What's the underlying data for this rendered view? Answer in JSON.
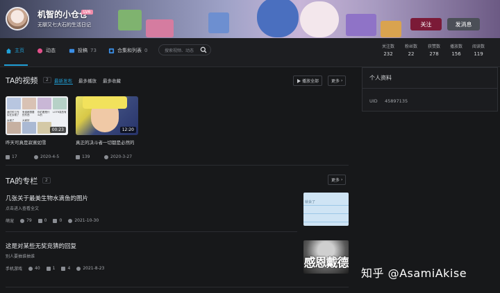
{
  "header": {
    "username": "机智的小仓仓",
    "level": "LV6",
    "signature": "无聊又七大石的生活日记",
    "follow_label": "关注",
    "message_label": "发消息"
  },
  "nav": {
    "items": [
      {
        "label": "主页",
        "icon": "home-icon"
      },
      {
        "label": "动态",
        "icon": "dynamic-icon"
      },
      {
        "label": "投稿",
        "count": "73",
        "icon": "upload-icon"
      },
      {
        "label": "合集和列表",
        "count": "0",
        "icon": "collection-icon"
      }
    ],
    "search_placeholder": "搜索视频、动态",
    "stats": [
      {
        "label": "关注数",
        "value": "232"
      },
      {
        "label": "粉丝数",
        "value": "22"
      },
      {
        "label": "获赞数",
        "value": "278"
      },
      {
        "label": "播放数",
        "value": "156"
      },
      {
        "label": "阅读数",
        "value": "119"
      }
    ]
  },
  "videos": {
    "title": "TA的视频",
    "count": "2",
    "tabs": [
      "最新发布",
      "最多播放",
      "最多收藏"
    ],
    "play_all_label": "播放全部",
    "more_label": "更多",
    "items": [
      {
        "title": "昨天可真是寂寞如雪",
        "duration": "00:23",
        "plays": "17",
        "date": "2020-4-5"
      },
      {
        "title": "真正的决斗者一切都是必然的",
        "duration": "12:20",
        "plays": "139",
        "date": "2020-3-27"
      }
    ],
    "thumb1_captions": [
      "我们的工作实在太难了",
      "有谁都想要的东西",
      "你们看是什么的",
      "LOTR真的有",
      "太难了",
      "大家好"
    ]
  },
  "articles": {
    "title": "TA的专栏",
    "count": "2",
    "more_label": "更多",
    "items": [
      {
        "title": "几张关于最美生物水滴鱼的图片",
        "subtitle": "点击进入查看全文",
        "category": "萌宠",
        "views": "79",
        "likes": "0",
        "comments": "0",
        "date": "2021-10-30",
        "image_caption": "就会了"
      },
      {
        "title": "这是对某些无奖竞猜的回复",
        "subtitle": "别人要抽谁抽谁",
        "category": "手机游戏",
        "views": "40",
        "likes": "1",
        "comments": "4",
        "date": "2021-8-23",
        "image_text": "感恩戴德"
      }
    ]
  },
  "profile": {
    "title": "个人资料",
    "uid_label": "UID",
    "uid_value": "45897135"
  },
  "watermark": "知乎 @AsamiAkise",
  "colors": {
    "accent": "#20a1d8",
    "follow": "#7b1a37",
    "background": "#17181a"
  }
}
